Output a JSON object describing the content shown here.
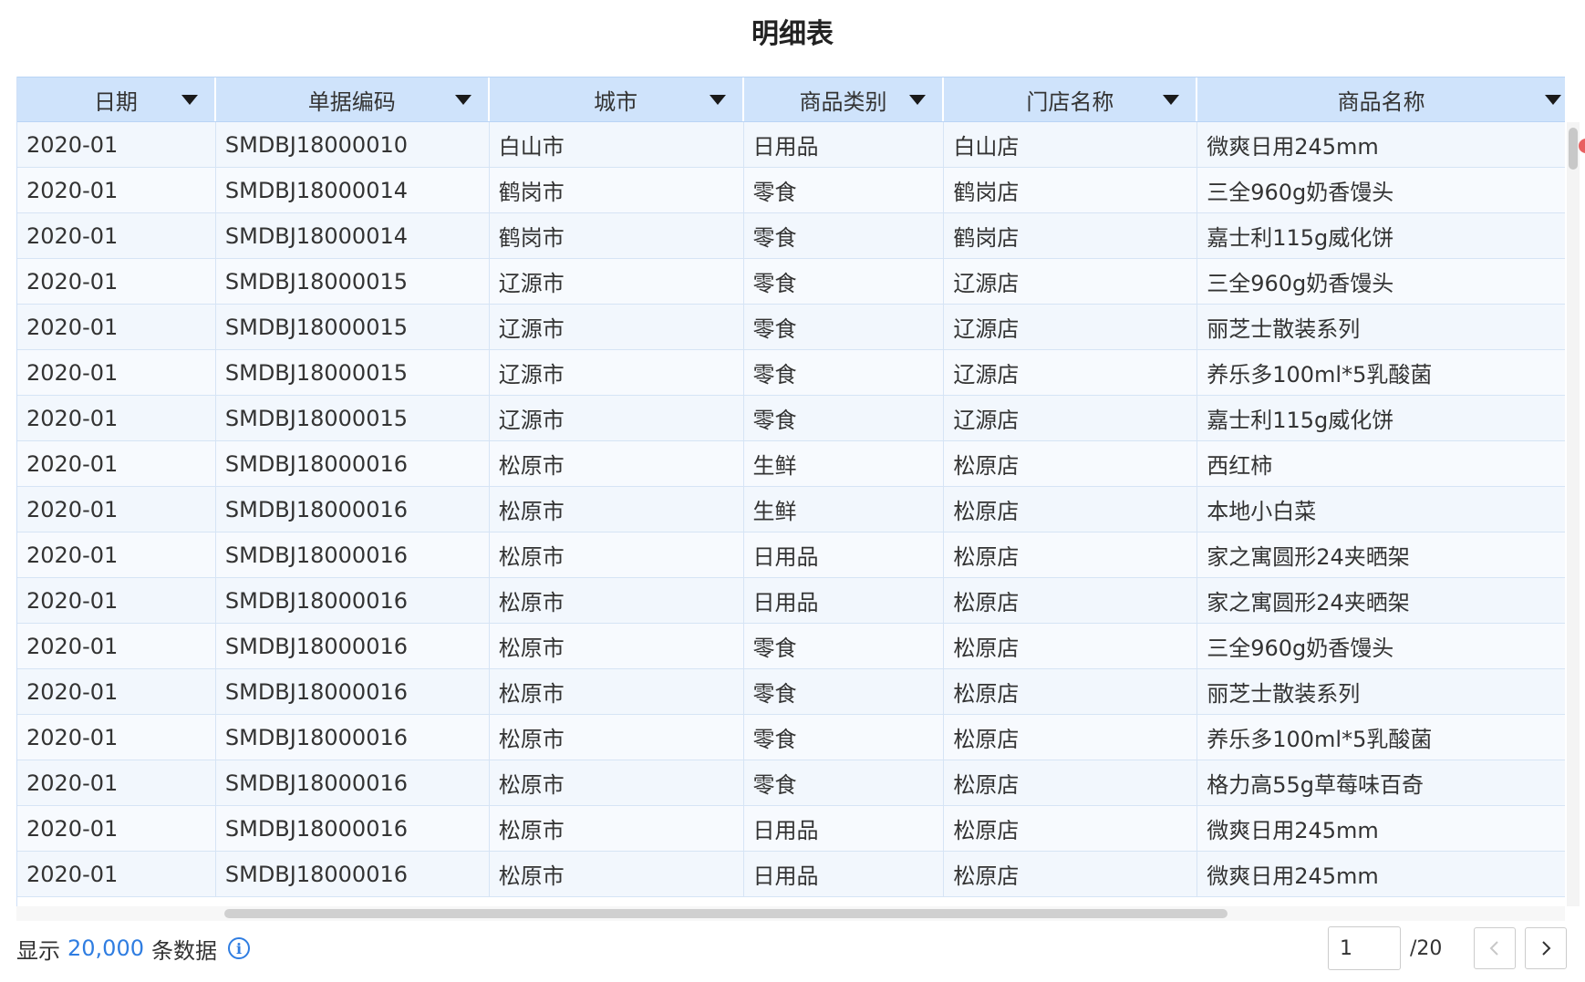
{
  "title": "明细表",
  "columns": [
    {
      "label": "日期"
    },
    {
      "label": "单据编码"
    },
    {
      "label": "城市"
    },
    {
      "label": "商品类别"
    },
    {
      "label": "门店名称"
    },
    {
      "label": "商品名称"
    }
  ],
  "rows": [
    [
      "2020-01",
      "SMDBJ18000010",
      "白山市",
      "日用品",
      "白山店",
      "微爽日用245mm"
    ],
    [
      "2020-01",
      "SMDBJ18000014",
      "鹤岗市",
      "零食",
      "鹤岗店",
      "三全960g奶香馒头"
    ],
    [
      "2020-01",
      "SMDBJ18000014",
      "鹤岗市",
      "零食",
      "鹤岗店",
      "嘉士利115g威化饼"
    ],
    [
      "2020-01",
      "SMDBJ18000015",
      "辽源市",
      "零食",
      "辽源店",
      "三全960g奶香馒头"
    ],
    [
      "2020-01",
      "SMDBJ18000015",
      "辽源市",
      "零食",
      "辽源店",
      "丽芝士散装系列"
    ],
    [
      "2020-01",
      "SMDBJ18000015",
      "辽源市",
      "零食",
      "辽源店",
      "养乐多100ml*5乳酸菌"
    ],
    [
      "2020-01",
      "SMDBJ18000015",
      "辽源市",
      "零食",
      "辽源店",
      "嘉士利115g威化饼"
    ],
    [
      "2020-01",
      "SMDBJ18000016",
      "松原市",
      "生鲜",
      "松原店",
      "西红柿"
    ],
    [
      "2020-01",
      "SMDBJ18000016",
      "松原市",
      "生鲜",
      "松原店",
      "本地小白菜"
    ],
    [
      "2020-01",
      "SMDBJ18000016",
      "松原市",
      "日用品",
      "松原店",
      "家之寓圆形24夹晒架"
    ],
    [
      "2020-01",
      "SMDBJ18000016",
      "松原市",
      "日用品",
      "松原店",
      "家之寓圆形24夹晒架"
    ],
    [
      "2020-01",
      "SMDBJ18000016",
      "松原市",
      "零食",
      "松原店",
      "三全960g奶香馒头"
    ],
    [
      "2020-01",
      "SMDBJ18000016",
      "松原市",
      "零食",
      "松原店",
      "丽芝士散装系列"
    ],
    [
      "2020-01",
      "SMDBJ18000016",
      "松原市",
      "零食",
      "松原店",
      "养乐多100ml*5乳酸菌"
    ],
    [
      "2020-01",
      "SMDBJ18000016",
      "松原市",
      "零食",
      "松原店",
      "格力高55g草莓味百奇"
    ],
    [
      "2020-01",
      "SMDBJ18000016",
      "松原市",
      "日用品",
      "松原店",
      "微爽日用245mm"
    ],
    [
      "2020-01",
      "SMDBJ18000016",
      "松原市",
      "日用品",
      "松原店",
      "微爽日用245mm"
    ]
  ],
  "footer": {
    "prefix": "显示",
    "count": "20,000",
    "suffix": "条数据",
    "info_icon": "info-icon"
  },
  "pagination": {
    "current_page": "1",
    "total": "/20",
    "prev_icon": "chevron-left-icon",
    "next_icon": "chevron-right-icon"
  },
  "colors": {
    "header_bg": "#cfe3fb",
    "row_bg": "#f2f7fd",
    "accent": "#2f7de1"
  }
}
